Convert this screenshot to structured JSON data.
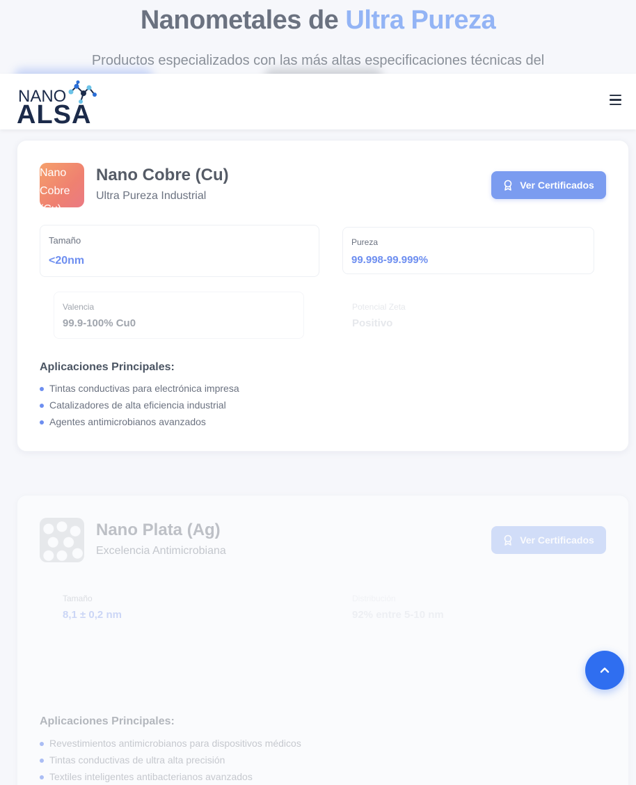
{
  "hero": {
    "title_prefix": "Nanometales de",
    "title_accent": "Ultra Pureza",
    "subtitle": "Productos especializados con las más altas especificaciones técnicas del"
  },
  "navbar": {
    "logo_top": "NANO",
    "logo_bottom": "ALSA",
    "menu_icon": "hamburger-icon"
  },
  "products": [
    {
      "image_alt": "Nano Cobre (Cu)",
      "name": "Nano Cobre (Cu)",
      "tagline": "Ultra Pureza Industrial",
      "button": "Ver Certificados",
      "specs": [
        {
          "label": "Tamaño",
          "value": "<20nm"
        },
        {
          "label": "Pureza",
          "value": "99.998-99.999%"
        },
        {
          "label": "Valencia",
          "value": "99.9-100% Cu0"
        },
        {
          "label": "Potencial Zeta",
          "value": "Positivo"
        }
      ],
      "apps_title": "Aplicaciones Principales:",
      "apps": [
        "Tintas conductivas para electrónica impresa",
        "Catalizadores de alta eficiencia industrial",
        "Agentes antimicrobianos avanzados"
      ]
    },
    {
      "name": "Nano Plata (Ag)",
      "tagline": "Excelencia Antimicrobiana",
      "button": "Ver Certificados",
      "specs": [
        {
          "label": "Tamaño",
          "value": "8,1 ± 0,2 nm"
        },
        {
          "label": "Distribución",
          "value": "92% entre 5-10 nm"
        }
      ],
      "apps_title": "Aplicaciones Principales:",
      "apps": [
        "Revestimientos antimicrobianos para dispositivos médicos",
        "Tintas conductivas de ultra alta precisión",
        "Textiles inteligentes antibacterianos avanzados"
      ]
    }
  ],
  "scroll_top_icon": "chevron-up-icon",
  "colors": {
    "accent": "#7b9cf0",
    "accent_text": "#6d8ef0",
    "brand_dark": "#1c2b4a",
    "scroll_button": "#2f6ef0"
  }
}
